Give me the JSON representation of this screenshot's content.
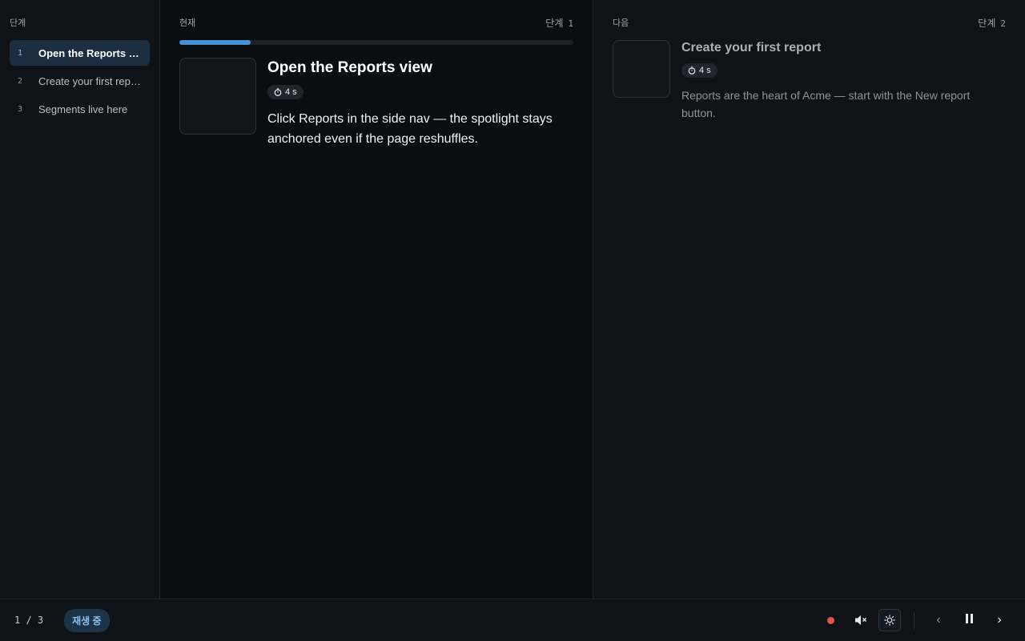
{
  "sidebar": {
    "heading": "단계",
    "items": [
      {
        "num": "1",
        "label": "Open the Reports view",
        "active": true
      },
      {
        "num": "2",
        "label": "Create your first report",
        "active": false
      },
      {
        "num": "3",
        "label": "Segments live here",
        "active": false
      }
    ]
  },
  "current": {
    "label": "현재",
    "step_prefix": "단계",
    "step_num": "1",
    "progress": 0.18,
    "title": "Open the Reports view",
    "timer": "4 s",
    "description": "Click Reports in the side nav — the spotlight stays anchored even if the page reshuffles."
  },
  "next": {
    "label": "다음",
    "step_prefix": "단계",
    "step_num": "2",
    "title": "Create your first report",
    "timer": "4 s",
    "description": "Reports are the heart of Acme — start with the New report button."
  },
  "bottom": {
    "counter": "1 / 3",
    "status": "재생 중",
    "controls": {
      "record_icon": "record-dot-icon",
      "mute_icon": "speaker-muted-icon",
      "theme_icon": "sun-icon",
      "prev_glyph": "‹",
      "next_glyph": "›",
      "pause_icon": "pause-icon"
    }
  },
  "colors": {
    "accent": "#4a90d0",
    "record": "#e5534b",
    "active_bg": "#1c2e40"
  }
}
